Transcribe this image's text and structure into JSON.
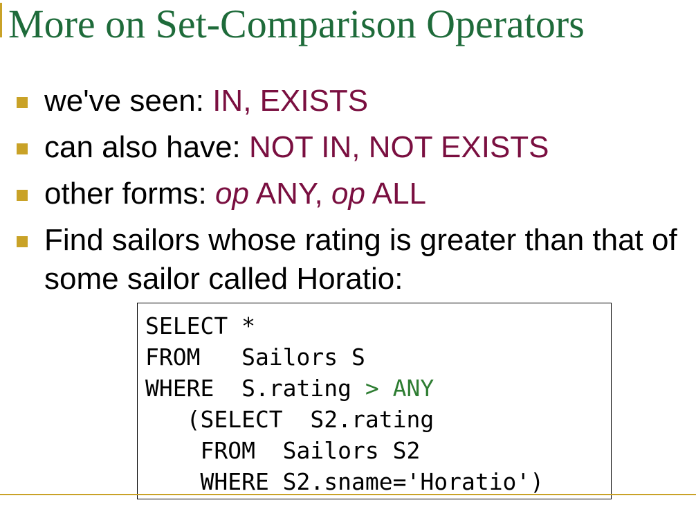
{
  "title": "More on Set-Comparison Operators",
  "colors": {
    "title": "#1e6b3a",
    "keyword": "#7a0f40",
    "bullet_marker": "#c9a227",
    "sql_operator": "#2e7d32",
    "rule": "#c9a227"
  },
  "bullets": [
    {
      "prefix": "we've seen: ",
      "keywords": "IN, EXISTS"
    },
    {
      "prefix": "can also have: ",
      "keywords": "NOT IN, NOT EXISTS"
    },
    {
      "prefix": "other forms: ",
      "op1": "op",
      "any": " ANY, ",
      "op2": "op",
      "all": " ALL"
    },
    {
      "text": "Find sailors whose rating is greater than that of some sailor called Horatio:"
    }
  ],
  "sql": {
    "line1": "SELECT *",
    "line2": "FROM   Sailors S",
    "line3_pre": "WHERE  S.rating ",
    "line3_op": "> ANY",
    "line4": "   (SELECT  S2.rating",
    "line5": "    FROM  Sailors S2",
    "line6": "    WHERE S2.sname='Horatio')"
  }
}
